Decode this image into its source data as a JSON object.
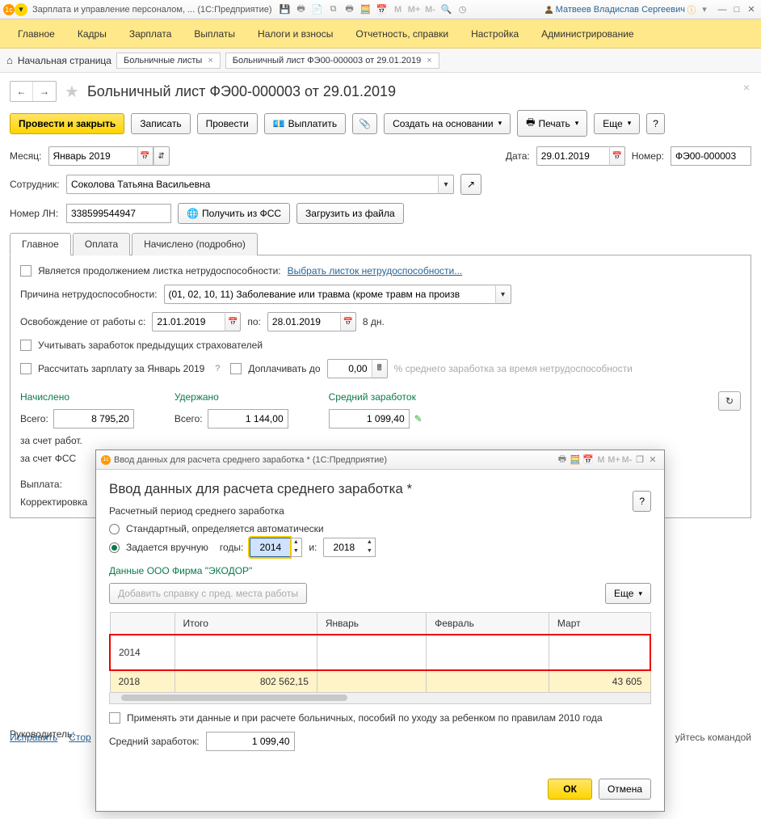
{
  "titlebar": {
    "app_title": "Зарплата и управление персоналом, ... (1С:Предприятие)",
    "user_name": "Матвеев Владислав Сергеевич"
  },
  "mainmenu": [
    "Главное",
    "Кадры",
    "Зарплата",
    "Выплаты",
    "Налоги и взносы",
    "Отчетность, справки",
    "Настройка",
    "Администрирование"
  ],
  "breadcrumb": {
    "home": "Начальная страница",
    "tabs": [
      {
        "label": "Больничные листы"
      },
      {
        "label": "Больничный лист ФЭ00-000003 от 29.01.2019"
      }
    ]
  },
  "doc": {
    "title": "Больничный лист ФЭ00-000003 от 29.01.2019",
    "toolbar": {
      "primary": "Провести и закрыть",
      "save": "Записать",
      "post": "Провести",
      "pay": "Выплатить",
      "create_on": "Создать на основании",
      "print": "Печать",
      "more": "Еще",
      "help": "?"
    },
    "fields": {
      "month_label": "Месяц:",
      "month_value": "Январь 2019",
      "date_label": "Дата:",
      "date_value": "29.01.2019",
      "number_label": "Номер:",
      "number_value": "ФЭ00-000003",
      "employee_label": "Сотрудник:",
      "employee_value": "Соколова Татьяна Васильевна",
      "ln_label": "Номер ЛН:",
      "ln_value": "338599544947",
      "get_fss": "Получить из ФСС",
      "load_file": "Загрузить из файла"
    },
    "tabs": [
      "Главное",
      "Оплата",
      "Начислено (подробно)"
    ],
    "main_tab": {
      "continuation_label": "Является продолжением листка нетрудоспособности:",
      "continuation_link": "Выбрать листок нетрудоспособности...",
      "reason_label": "Причина нетрудоспособности:",
      "reason_value": "(01, 02, 10, 11) Заболевание или травма (кроме травм на произв",
      "release_label": "Освобождение от работы с:",
      "release_from": "21.01.2019",
      "release_to_label": "по:",
      "release_to": "28.01.2019",
      "days": "8 дн.",
      "prev_insurers": "Учитывать заработок предыдущих страхователей",
      "recalc": "Рассчитать зарплату за Январь 2019",
      "topup_label": "Доплачивать до",
      "topup_value": "0,00",
      "topup_suffix": "% среднего заработка за время нетрудоспособности"
    },
    "totals": {
      "accrued_h": "Начислено",
      "withheld_h": "Удержано",
      "avg_h": "Средний заработок",
      "total_label": "Всего:",
      "accrued_total": "8 795,20",
      "withheld_total": "1 144,00",
      "avg_value": "1 099,40",
      "by_employer": "за счет работ.",
      "by_fss": "за счет ФСС",
      "payout": "Выплата:",
      "correction": "Корректировка"
    },
    "footer": {
      "head_label": "Руководитель:",
      "fix": "Исправить",
      "storno": "Стор",
      "hint": "уйтесь командой"
    }
  },
  "modal": {
    "titlebar": "Ввод данных для расчета среднего заработка * (1С:Предприятие)",
    "heading": "Ввод данных для расчета среднего заработка *",
    "period_label": "Расчетный период среднего заработка",
    "r_auto": "Стандартный, определяется автоматически",
    "r_manual": "Задается вручную",
    "years_label": "годы:",
    "year_from": "2014",
    "and": "и:",
    "year_to": "2018",
    "org_label": "Данные ООО Фирма \"ЭКОДОР\"",
    "add_ref": "Добавить справку с пред. места работы",
    "more": "Еще",
    "help": "?",
    "table": {
      "headers": [
        "",
        "Итого",
        "Январь",
        "Февраль",
        "Март"
      ],
      "rows": [
        {
          "year": "2014",
          "total": "",
          "m1": "",
          "m2": "",
          "m3": ""
        },
        {
          "year": "2018",
          "total": "802 562,15",
          "m1": "",
          "m2": "",
          "m3": "43 605"
        }
      ]
    },
    "apply_2010": "Применять эти данные и при расчете больничных, пособий по уходу за ребенком по правилам 2010 года",
    "avg_label": "Средний заработок:",
    "avg_value": "1 099,40",
    "ok": "ОК",
    "cancel": "Отмена"
  }
}
